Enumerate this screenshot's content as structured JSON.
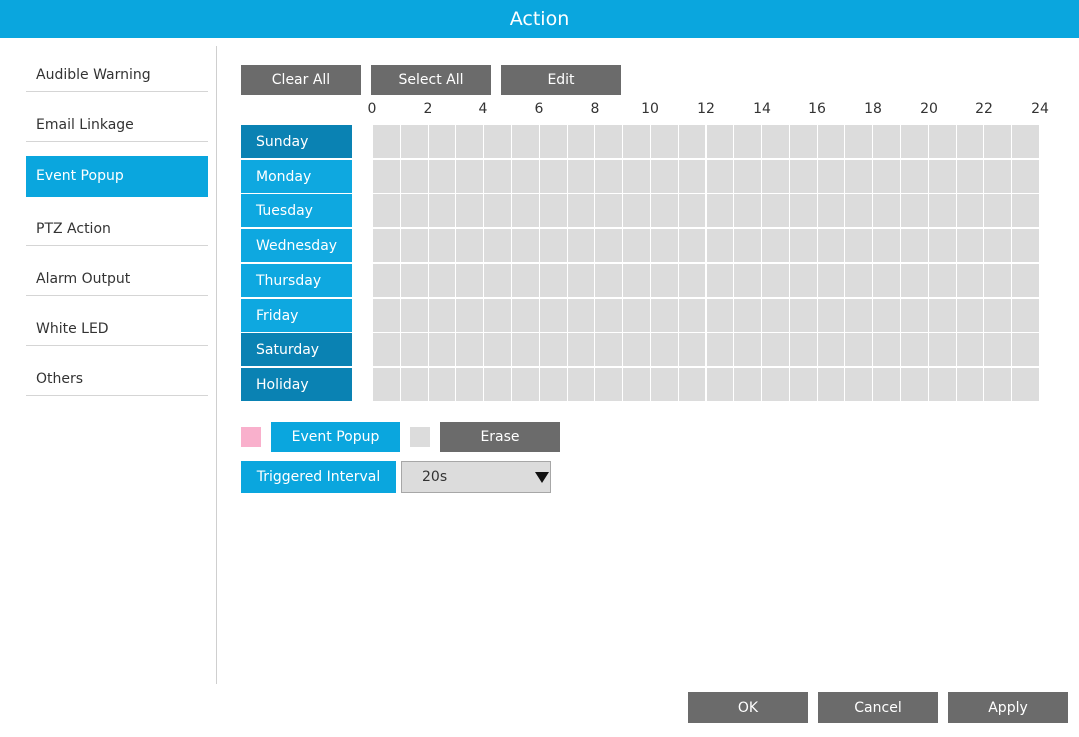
{
  "header": {
    "title": "Action"
  },
  "sidebar": {
    "items": [
      {
        "label": "Audible Warning",
        "active": false
      },
      {
        "label": "Email Linkage",
        "active": false
      },
      {
        "label": "Event Popup",
        "active": true
      },
      {
        "label": "PTZ Action",
        "active": false
      },
      {
        "label": "Alarm Output",
        "active": false
      },
      {
        "label": "White LED",
        "active": false
      },
      {
        "label": "Others",
        "active": false
      }
    ]
  },
  "toolbar": {
    "clear_all": "Clear All",
    "select_all": "Select All",
    "edit": "Edit"
  },
  "schedule": {
    "hour_labels": [
      "0",
      "2",
      "4",
      "6",
      "8",
      "10",
      "12",
      "14",
      "16",
      "18",
      "20",
      "22",
      "24"
    ],
    "days": [
      {
        "label": "Sunday",
        "style": "dark"
      },
      {
        "label": "Monday",
        "style": "light"
      },
      {
        "label": "Tuesday",
        "style": "light"
      },
      {
        "label": "Wednesday",
        "style": "light"
      },
      {
        "label": "Thursday",
        "style": "light"
      },
      {
        "label": "Friday",
        "style": "light"
      },
      {
        "label": "Saturday",
        "style": "dark"
      },
      {
        "label": "Holiday",
        "style": "dark"
      }
    ],
    "selected_cells": []
  },
  "legend": {
    "event_popup_color": "#f9b0cc",
    "event_popup_label": "Event Popup",
    "erase_color": "#dcdcdc",
    "erase_label": "Erase"
  },
  "interval": {
    "label": "Triggered Interval",
    "value": "20s"
  },
  "footer": {
    "ok": "OK",
    "cancel": "Cancel",
    "apply": "Apply"
  },
  "colors": {
    "accent": "#0aa6de",
    "day_dark": "#0a82b3",
    "button_gray": "#6b6b6b",
    "cell_gray": "#dcdcdc"
  }
}
